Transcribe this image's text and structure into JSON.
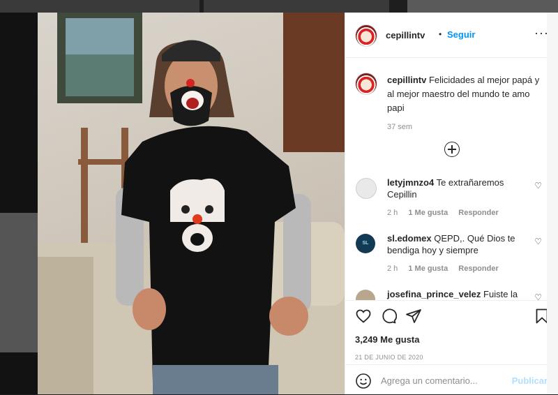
{
  "post": {
    "username": "cepillintv",
    "follow_separator": "•",
    "follow_label": "Seguir",
    "more_icon": "more-horizontal-icon",
    "caption": "Felicidades al mejor papá y al mejor maestro del mundo te amo papi",
    "caption_time": "37 sem",
    "load_more_icon": "plus-circle-icon"
  },
  "comments": [
    {
      "username": "letyjmnzo4",
      "text": "Te extrañaremos Cepillin",
      "time": "2 h",
      "likes": "1 Me gusta",
      "reply": "Responder"
    },
    {
      "username": "sl.edomex",
      "text": "QEPD,. Qué Dios te bendiga hoy y siempre",
      "time": "2 h",
      "likes": "1 Me gusta",
      "reply": "Responder",
      "avatar_text": "SL"
    },
    {
      "username": "josefina_prince_velez",
      "text": "Fuiste la"
    }
  ],
  "actions": {
    "icons": [
      "heart-icon",
      "comment-icon",
      "share-icon",
      "bookmark-icon"
    ],
    "likes": "3,249 Me gusta",
    "date": "21 DE JUNIO DE 2020"
  },
  "add_comment": {
    "placeholder": "Agrega un comentario...",
    "publish": "Publicar",
    "emoji_icon": "emoji-icon"
  },
  "colors": {
    "accent": "#0095f6",
    "publish_disabled": "#b2dffc",
    "text": "#262626",
    "muted": "#8e8e8e"
  }
}
